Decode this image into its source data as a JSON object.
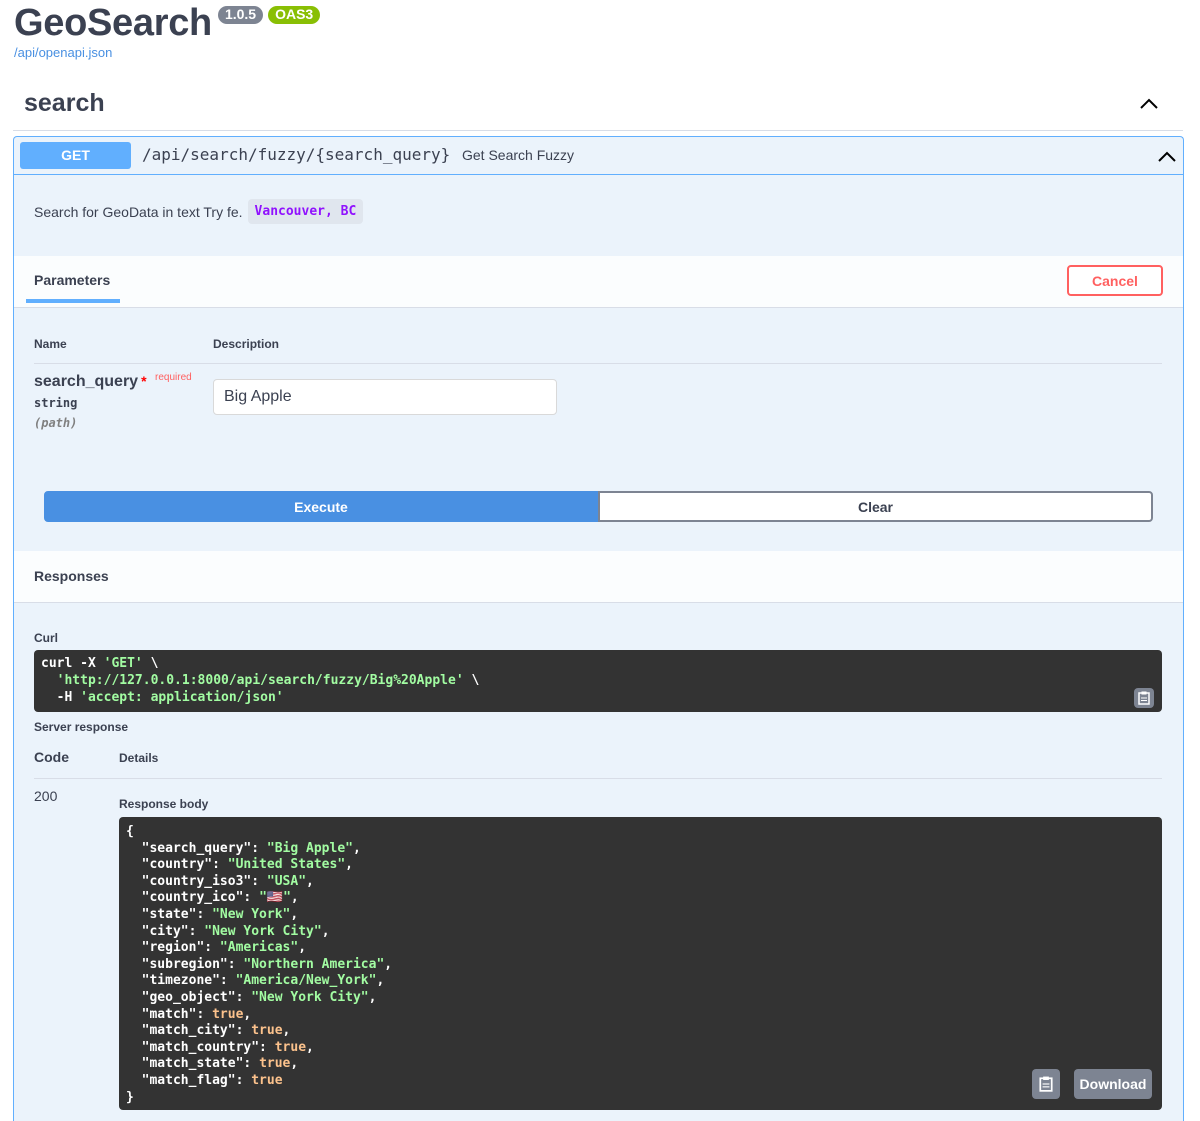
{
  "header": {
    "title": "GeoSearch",
    "version_badge": "1.0.5",
    "oas_badge": "OAS3",
    "spec_link": "/api/openapi.json"
  },
  "tag": {
    "name": "search"
  },
  "operation": {
    "method": "GET",
    "path": "/api/search/fuzzy/{search_query}",
    "summary": "Get Search Fuzzy",
    "description_text": "Search for GeoData in text Try fe.",
    "description_code": "Vancouver, BC"
  },
  "parameters": {
    "tab_label": "Parameters",
    "cancel_label": "Cancel",
    "col_name": "Name",
    "col_description": "Description",
    "items": [
      {
        "name": "search_query",
        "required_star": "*",
        "required_label": "required",
        "type": "string",
        "in": "(path)",
        "value": "Big Apple"
      }
    ]
  },
  "actions": {
    "execute_label": "Execute",
    "clear_label": "Clear"
  },
  "responses": {
    "title": "Responses",
    "curl_label": "Curl",
    "curl": {
      "line1_cmd": "curl -X ",
      "line1_method": "'GET'",
      "line1_tail": " \\",
      "line2_url": "'http://127.0.0.1:8000/api/search/fuzzy/Big%20Apple'",
      "line2_tail": " \\",
      "line3_flag": "  -H ",
      "line3_header": "'accept: application/json'"
    },
    "server_response_label": "Server response",
    "code_col": "Code",
    "details_col": "Details",
    "status_code": "200",
    "response_body_label": "Response body",
    "body": [
      {
        "key": "search_query",
        "value": "Big Apple",
        "kind": "string"
      },
      {
        "key": "country",
        "value": "United States",
        "kind": "string"
      },
      {
        "key": "country_iso3",
        "value": "USA",
        "kind": "string"
      },
      {
        "key": "country_ico",
        "value": "🇺🇸",
        "kind": "string"
      },
      {
        "key": "state",
        "value": "New York",
        "kind": "string"
      },
      {
        "key": "city",
        "value": "New York City",
        "kind": "string"
      },
      {
        "key": "region",
        "value": "Americas",
        "kind": "string"
      },
      {
        "key": "subregion",
        "value": "Northern America",
        "kind": "string"
      },
      {
        "key": "timezone",
        "value": "America/New_York",
        "kind": "string"
      },
      {
        "key": "geo_object",
        "value": "New York City",
        "kind": "string"
      },
      {
        "key": "match",
        "value": "true",
        "kind": "bool"
      },
      {
        "key": "match_city",
        "value": "true",
        "kind": "bool"
      },
      {
        "key": "match_country",
        "value": "true",
        "kind": "bool"
      },
      {
        "key": "match_state",
        "value": "true",
        "kind": "bool"
      },
      {
        "key": "match_flag",
        "value": "true",
        "kind": "bool"
      }
    ],
    "download_label": "Download"
  },
  "icons": {
    "tag_toggle": "chevron-up-icon",
    "op_toggle": "chevron-up-icon",
    "copy": "clipboard-icon"
  },
  "colors": {
    "get_method": "#61affe",
    "execute": "#4990e2",
    "cancel": "#ff6060",
    "oas_badge": "#89bf04",
    "version_badge": "#7d8492",
    "code_bg": "#333333",
    "json_string": "#a2fca2",
    "json_bool": "#fcc28c",
    "inline_code": "#9012fe"
  }
}
